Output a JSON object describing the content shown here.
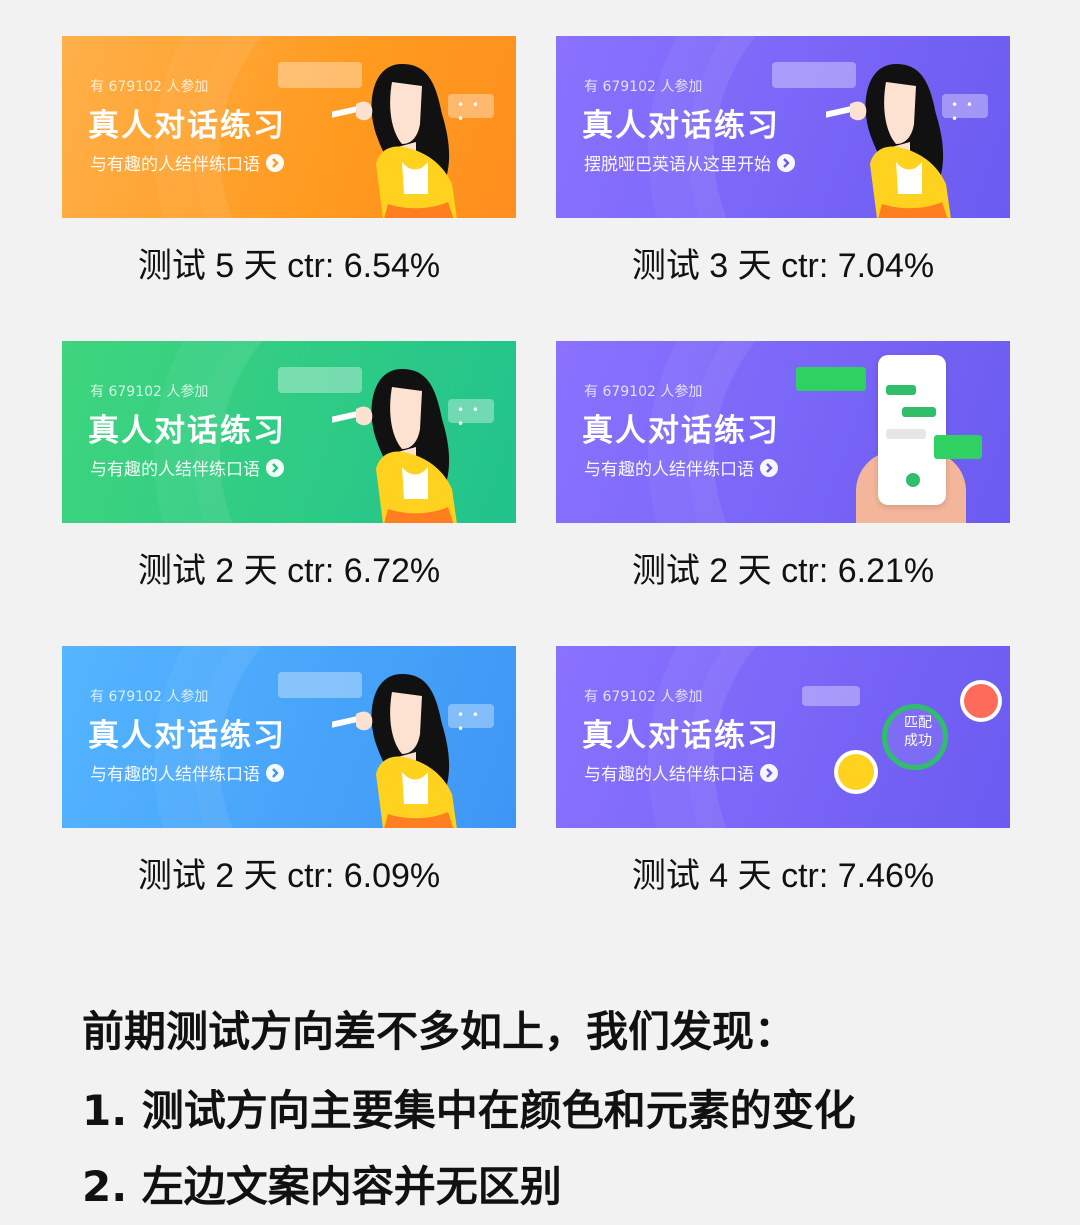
{
  "cards": [
    {
      "participants": "有 679102 人参加",
      "headline": "真人对话练习",
      "subline": "与有趣的人结伴练口语",
      "caption": "测试 5 天   ctr: 6.54%",
      "theme": "#ff9a1f"
    },
    {
      "participants": "有 679102 人参加",
      "headline": "真人对话练习",
      "subline": "摆脱哑巴英语从这里开始",
      "caption": "测试 3 天   ctr: 7.04%",
      "theme": "#6b5bf0"
    },
    {
      "participants": "有 679102 人参加",
      "headline": "真人对话练习",
      "subline": "与有趣的人结伴练口语",
      "caption": "测试 2 天   ctr: 6.72%",
      "theme": "#21c38d"
    },
    {
      "participants": "有 679102 人参加",
      "headline": "真人对话练习",
      "subline": "与有趣的人结伴练口语",
      "caption": "测试 2 天   ctr: 6.21%",
      "theme": "#6b5bf0"
    },
    {
      "participants": "有 679102 人参加",
      "headline": "真人对话练习",
      "subline": "与有趣的人结伴练口语",
      "caption": "测试 2 天   ctr: 6.09%",
      "theme": "#3d96f5"
    },
    {
      "participants": "有 679102 人参加",
      "headline": "真人对话练习",
      "subline": "与有趣的人结伴练口语",
      "caption": "测试 4 天   ctr: 7.46%",
      "theme": "#6b5bf0",
      "match_text": "匹配成功"
    }
  ],
  "summary": {
    "intro": "前期测试方向差不多如上，我们发现：",
    "point1": "1.  测试方向主要集中在颜色和元素的变化",
    "point2": "2. 左边文案内容并无区别"
  },
  "bubble_dots": "• • •"
}
